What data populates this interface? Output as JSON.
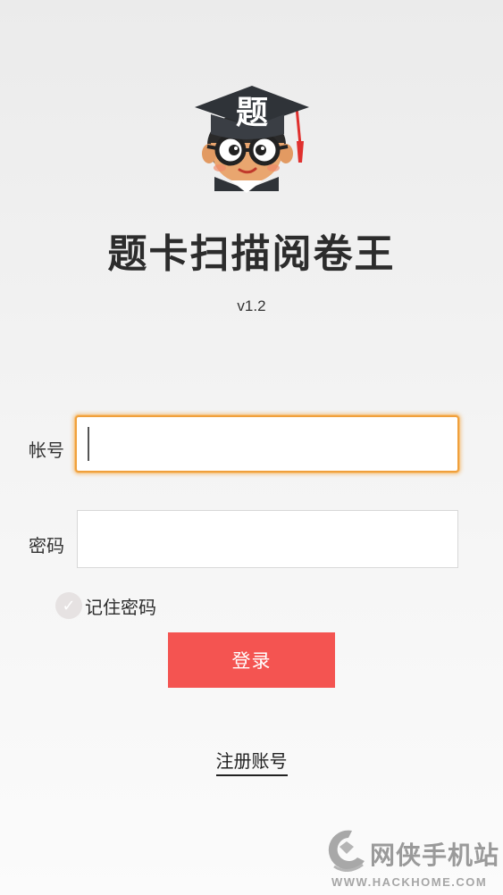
{
  "app": {
    "logo_icon": "student-mascot-icon",
    "logo_text": "题",
    "title": "题卡扫描阅卷王",
    "version": "v1.2"
  },
  "form": {
    "account_label": "帐号",
    "account_value": "",
    "password_label": "密码",
    "password_value": "",
    "remember_label": "记住密码",
    "remember_checked": false,
    "login_label": "登录",
    "register_label": "注册账号"
  },
  "watermark": {
    "icon": "hackhome-logo-icon",
    "text": "网侠手机站",
    "url": "WWW.HACKHOME.COM"
  },
  "colors": {
    "accent_button": "#f45451",
    "focus_border": "#f0a03c",
    "hat": "#2f3338",
    "tassel": "#e0302e"
  }
}
